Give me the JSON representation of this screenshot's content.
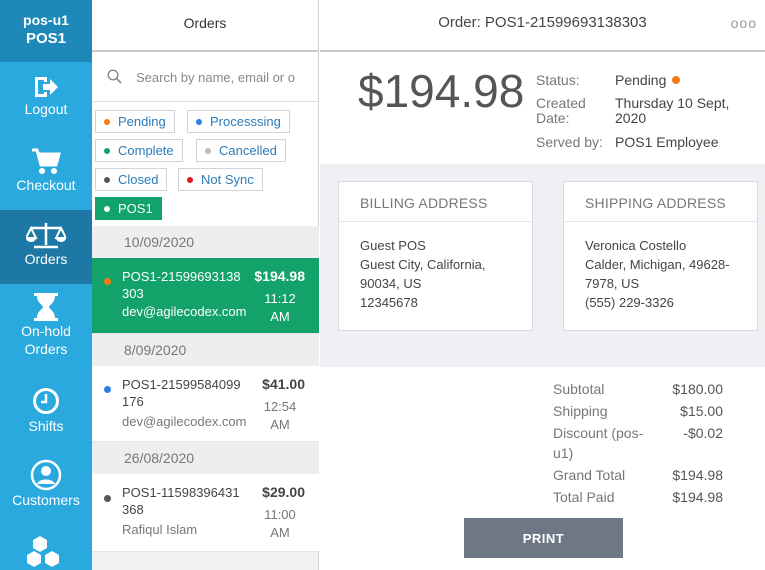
{
  "sidebar": {
    "user": "pos-u1",
    "register": "POS1",
    "items": [
      {
        "label": "Logout",
        "icon": "logout-icon"
      },
      {
        "label": "Checkout",
        "icon": "cart-icon"
      },
      {
        "label": "Orders",
        "icon": "scales-icon",
        "active": true
      },
      {
        "label": "On-hold Orders",
        "icon": "hourglass-icon"
      },
      {
        "label": "Shifts",
        "icon": "clock-icon"
      },
      {
        "label": "Customers",
        "icon": "user-icon"
      },
      {
        "label": "",
        "icon": "boxes-icon"
      }
    ]
  },
  "list": {
    "title": "Orders",
    "search_placeholder": "Search by name, email or o",
    "filters": [
      {
        "label": "Pending",
        "color": "#f57c12"
      },
      {
        "label": "Processsing",
        "color": "#2a7de1"
      },
      {
        "label": "Complete",
        "color": "#13a26a"
      },
      {
        "label": "Cancelled",
        "color": "#bbbbbb"
      },
      {
        "label": "Closed",
        "color": "#555555"
      },
      {
        "label": "Not Sync",
        "color": "#e0161e"
      },
      {
        "label": "POS1",
        "color": "#ffffff",
        "selected": true
      }
    ],
    "groups": [
      {
        "date": "10/09/2020"
      },
      {
        "date": "8/09/2020"
      },
      {
        "date": "26/08/2020"
      }
    ],
    "orders": [
      {
        "number": "POS1-21599693138303",
        "email": "dev@agilecodex.com",
        "amount": "$194.98",
        "time1": "11:12",
        "time2": "AM",
        "status_color": "#f57c12"
      },
      {
        "number": "POS1-21599584099176",
        "email": "dev@agilecodex.com",
        "amount": "$41.00",
        "time1": "12:54",
        "time2": "AM",
        "status_color": "#2a7de1"
      },
      {
        "number": "POS1-11598396431368",
        "email": "Rafiqul Islam",
        "amount": "$29.00",
        "time1": "11:00",
        "time2": "AM",
        "status_color": "#555555"
      }
    ]
  },
  "detail": {
    "title": "Order: POS1-21599693138303",
    "more": "ooo",
    "amount": "$194.98",
    "status_label": "Status:",
    "status_value": "Pending",
    "created_label_1": "Created",
    "created_label_2": "Date:",
    "created_value_1": "Thursday 10 Sept,",
    "created_value_2": "2020",
    "served_label": "Served by:",
    "served_value": "POS1 Employee",
    "billing": {
      "title": "BILLING ADDRESS",
      "lines": [
        "Guest POS",
        "Guest City, California,",
        "90034, US",
        "12345678"
      ]
    },
    "shipping": {
      "title": "SHIPPING ADDRESS",
      "lines": [
        "Veronica Costello",
        "Calder, Michigan, 49628-",
        "7978, US",
        "(555) 229-3326"
      ]
    },
    "totals": {
      "subtotal_label": "Subtotal",
      "subtotal": "$180.00",
      "shipping_label": "Shipping",
      "shipping": "$15.00",
      "discount_label_1": "Discount (pos-",
      "discount_label_2": "u1)",
      "discount": "-$0.02",
      "grand_label": "Grand Total",
      "grand": "$194.98",
      "paid_label": "Total Paid",
      "paid": "$194.98"
    },
    "print_label": "PRINT"
  },
  "colors": {
    "sidebar": "#29a9de",
    "sidebar_active": "#1d78a6",
    "selected_order": "#13a26a",
    "print_button": "#6e7885"
  }
}
